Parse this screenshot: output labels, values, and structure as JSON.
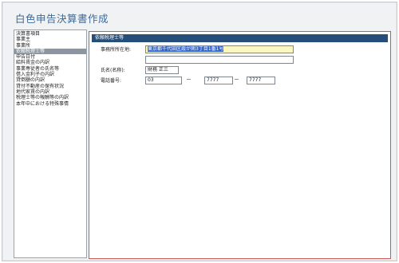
{
  "app": {
    "title": "白色申告決算書作成"
  },
  "sidebar": {
    "items": [
      {
        "label": "決算書項目"
      },
      {
        "label": "事業主"
      },
      {
        "label": "事業所"
      },
      {
        "label": "依頼税理士等"
      },
      {
        "label": "申告日付"
      },
      {
        "label": "給料賃金の内訳"
      },
      {
        "label": "事業専従者の氏名等"
      },
      {
        "label": "借入金利子の内訳"
      },
      {
        "label": "貸倒額の内訳"
      },
      {
        "label": "貸付不動産の保有状況"
      },
      {
        "label": "地代家賃の内訳"
      },
      {
        "label": "税理士等の報酬等の内訳"
      },
      {
        "label": "本年中における特殊事情"
      }
    ],
    "selected_index": 3
  },
  "form": {
    "header": "依頼税理士等",
    "address_label": "事務所所在地:",
    "address_line1": "東京都千代田区霞が関3丁目1番1号",
    "address_line2": "",
    "name_label": "氏名(名称):",
    "name_value": "財務 正三",
    "phone_label": "電話番号:",
    "phone_1": "03",
    "phone_sep": "－",
    "phone_2": "7777",
    "phone_3": "7777"
  },
  "colors": {
    "title": "#3e6a98",
    "header_bg": "#264e7a",
    "selected_bg": "#8c96a2",
    "active_field_bg": "#fbf7c0",
    "form_border": "#c85a5a"
  }
}
